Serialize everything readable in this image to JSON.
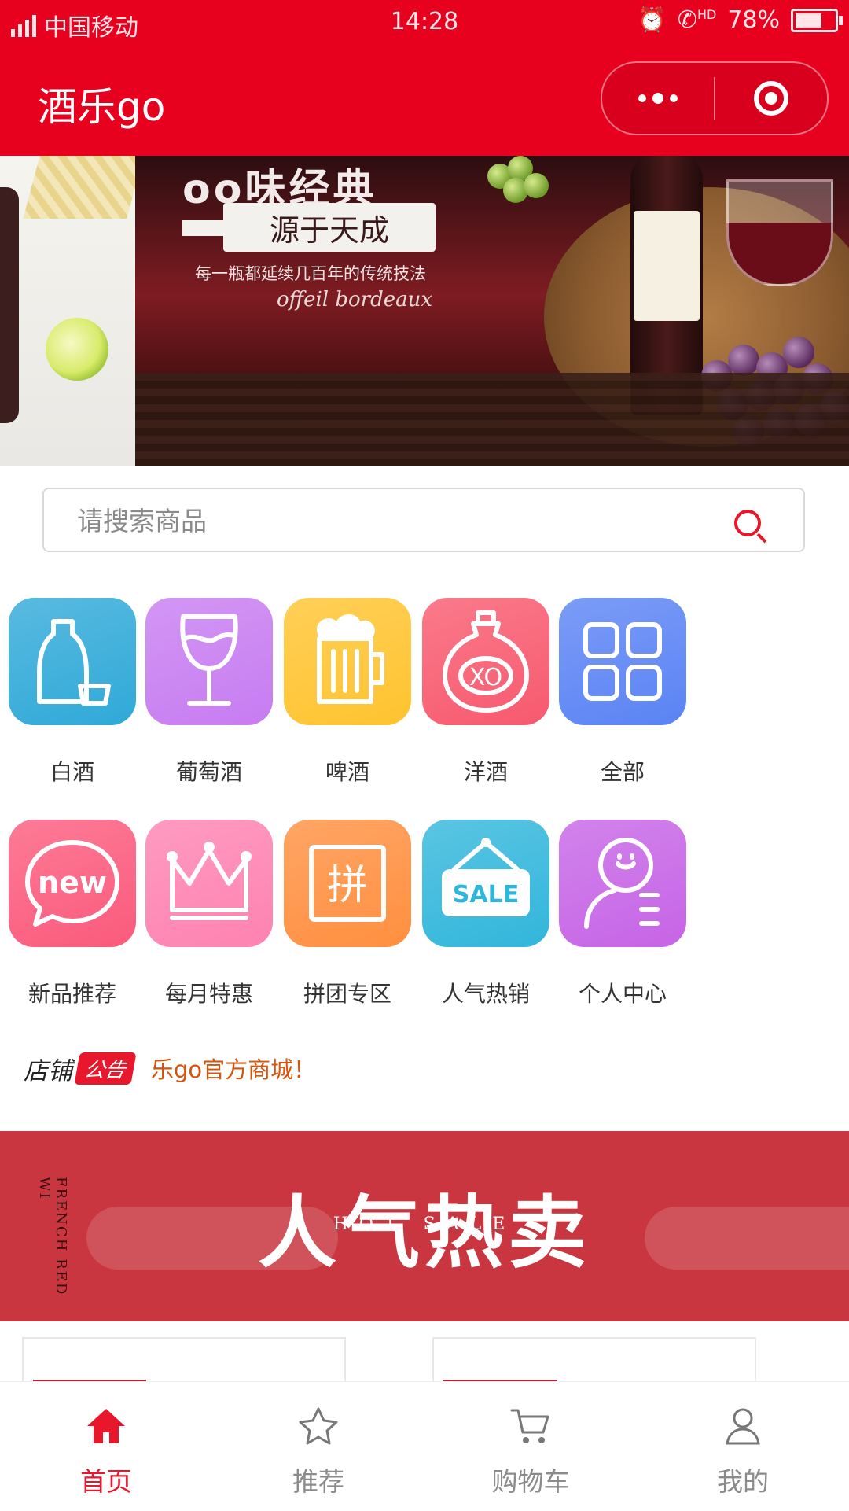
{
  "status_bar": {
    "network": "4G 4G",
    "carrier": "中国移动",
    "time": "14:28",
    "hd": "HD",
    "battery": "78%",
    "battery_level": 0.78
  },
  "nav": {
    "title": "酒乐go"
  },
  "banner": {
    "headline": "oo味经典",
    "tag": "源于天成",
    "sub": "每一瓶都延续几百年的传统技法",
    "script": "offeil bordeaux",
    "slide_count": 4,
    "active_slide": 2
  },
  "search": {
    "placeholder": "请搜索商品",
    "value": ""
  },
  "categories": [
    {
      "label": "白酒",
      "icon": "baijiu-bottle-icon",
      "color": "#2fa9d8"
    },
    {
      "label": "葡萄酒",
      "icon": "wine-glass-icon",
      "color": "#c77cf1"
    },
    {
      "label": "啤酒",
      "icon": "beer-mug-icon",
      "color": "#ffc32e"
    },
    {
      "label": "洋酒",
      "icon": "xo-bottle-icon",
      "color": "#f8596e"
    },
    {
      "label": "全部",
      "icon": "grid-icon",
      "color": "#5a83f4"
    },
    {
      "label": "新品推荐",
      "icon": "new-bubble-icon",
      "color": "#fb5a7c"
    },
    {
      "label": "每月特惠",
      "icon": "crown-icon",
      "color": "#fe82b0"
    },
    {
      "label": "拼团专区",
      "icon": "group-buy-icon",
      "color": "#ff8f3f"
    },
    {
      "label": "人气热销",
      "icon": "sale-sign-icon",
      "color": "#31b6db"
    },
    {
      "label": "个人中心",
      "icon": "user-profile-icon",
      "color": "#c664e6"
    }
  ],
  "notice": {
    "shop": "店铺",
    "tag": "公告",
    "text": "乐go官方商城！"
  },
  "hot_sale": {
    "title": "人气热卖",
    "subtitle": "HOT SALE",
    "side_text": "FRENCH RED WI"
  },
  "tabs": [
    {
      "label": "首页",
      "icon": "home-icon",
      "active": true
    },
    {
      "label": "推荐",
      "icon": "star-icon",
      "active": false
    },
    {
      "label": "购物车",
      "icon": "cart-icon",
      "active": false
    },
    {
      "label": "我的",
      "icon": "user-icon",
      "active": false
    }
  ],
  "colors": {
    "brand": "#e8001f",
    "accent": "#e8172b",
    "notice_text": "#d4540e",
    "hot_sale_bg": "#c9363f"
  }
}
